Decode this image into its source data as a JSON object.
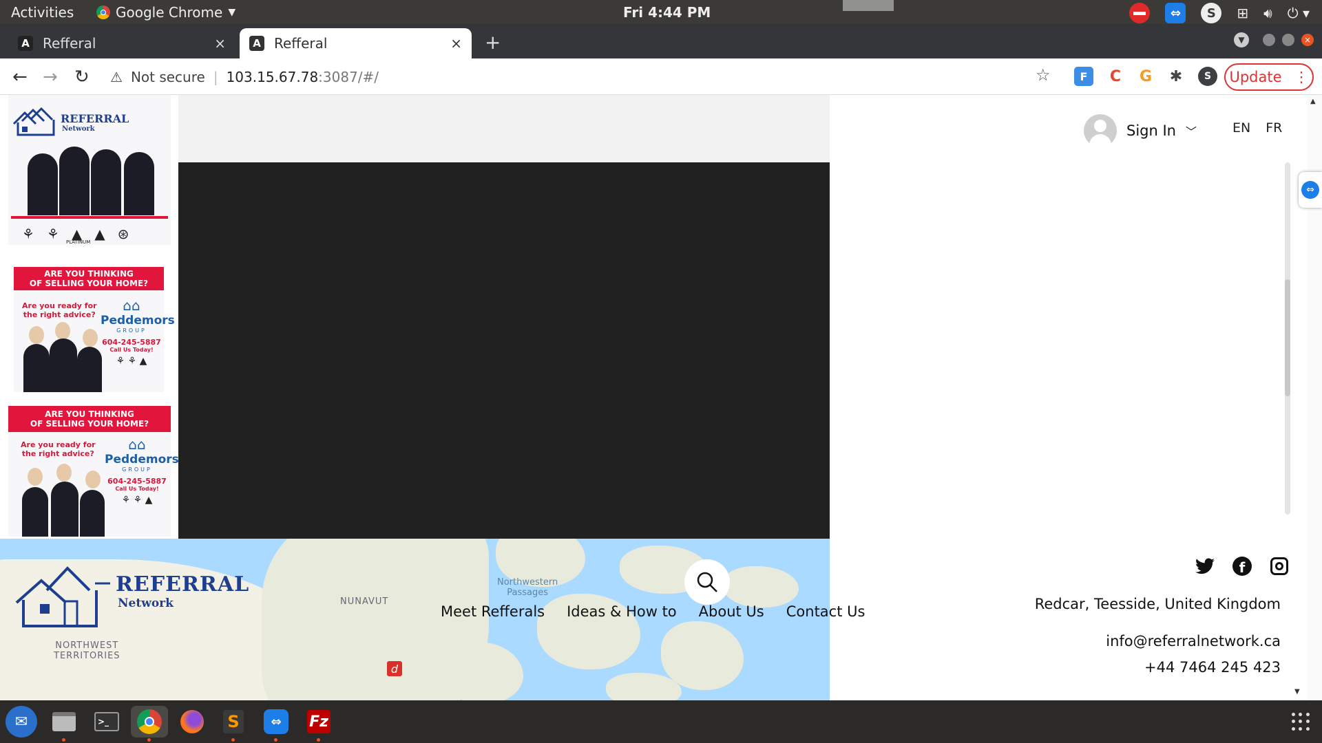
{
  "system_bar": {
    "activities": "Activities",
    "app_name": "Google Chrome",
    "clock": "Fri  4:44 PM"
  },
  "tabs": [
    {
      "label": "Refferal",
      "active": false
    },
    {
      "label": "Refferal",
      "active": true
    }
  ],
  "address_bar": {
    "security": "Not secure",
    "url_host": "103.15.67.78",
    "url_rest": ":3087/#/",
    "update_label": "Update",
    "profile_initial": "S"
  },
  "header": {
    "sign_in": "Sign In",
    "lang_en": "EN",
    "lang_fr": "FR"
  },
  "ads": [
    {
      "line1": "ARE YOU THINKING",
      "line2": "OF SELLING YOUR HOME?",
      "question1": "Are you ready for",
      "question2": "the right advice?",
      "brand": "Peddemors",
      "brand_sub": "GROUP",
      "phone": "604-245-5887",
      "cta": "Call Us Today!"
    },
    {
      "line1": "ARE YOU THINKING",
      "line2": "OF SELLING YOUR HOME?",
      "question1": "Are you ready for",
      "question2": "the right advice?",
      "brand": "Peddemors",
      "brand_sub": "GROUP",
      "phone": "604-245-5887",
      "cta": "Call Us Today!"
    }
  ],
  "ad_logo": {
    "brand": "REFERRAL",
    "sub": "Network",
    "badge": "PLATINUM"
  },
  "footer": {
    "logo_brand": "REFERRAL",
    "logo_sub": "Network",
    "map_labels": {
      "nunavut": "NUNAVUT",
      "nwt1": "NORTHWEST",
      "nwt2": "TERRITORIES",
      "passages1": "Northwestern",
      "passages2": "Passages"
    },
    "nav": [
      "Meet Refferals",
      "Ideas & How to",
      "About Us",
      "Contact Us"
    ],
    "address": "Redcar, Teesside, United Kingdom",
    "email": "info@referralnetwork.ca",
    "phone": "+44 7464 245 423"
  },
  "colors": {
    "accent_blue": "#1e3f8f",
    "ad_red": "#e2163c",
    "video_bg": "#212121",
    "map_water": "#aadaff"
  }
}
